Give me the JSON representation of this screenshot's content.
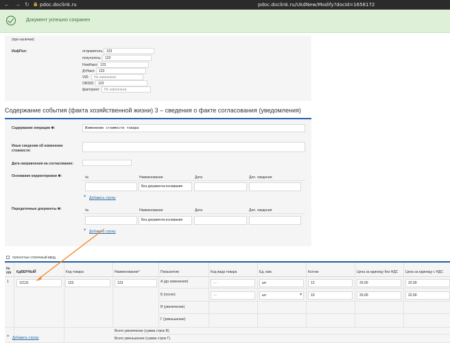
{
  "browser": {
    "site": "pdoc.doclink.ru",
    "url": "pdoc.doclink.ru/UkdNew/Modify?docId=1658172"
  },
  "alert": {
    "message": "Документ успешно сохранен"
  },
  "info": {
    "if_present_label": "(при наличии):",
    "infpol_label": "ИнфПол:",
    "fields": [
      {
        "label": "отправитель:",
        "value": "123"
      },
      {
        "label": "получатель:",
        "value": "123"
      },
      {
        "label": "НомНакл:",
        "value": "123"
      },
      {
        "label": "ДтНакл:",
        "value": "123"
      },
      {
        "label": "VID:",
        "value": "Не заполнено",
        "placeholder": true
      },
      {
        "label": "ORDID:",
        "value": "123"
      },
      {
        "label": "факторинг:",
        "value": "Не заполнена",
        "placeholder": true
      }
    ]
  },
  "section": {
    "title": "Содержание события (факта хозяйственной жизни) 3 – сведения о факте согласования (уведомления)",
    "content_label": "Содержание операции ✱:",
    "content_value": "Изменение стоимости товара",
    "other_info_label": "Иные сведения об изменении стоимости:",
    "send_date_label": "Дата направления на согласование:",
    "basis_label": "Основание корректировки ✱:",
    "transfer_label": "Передаточные документы ✱:",
    "cols": [
      "№",
      "Наименование",
      "Дата",
      "Доп. сведения"
    ],
    "doc_name_value": "Без документа-основания",
    "add_row": "Добавить строку"
  },
  "manual": {
    "label": "полностью статичный ввод"
  },
  "table": {
    "headers": [
      "№ п/п",
      "КдВЕРНЫЙ",
      "Код товара",
      "Наименование*",
      "Показатели",
      "Код вида товара",
      "Ед. изм.",
      "Кол-во",
      "Цена за единицу без НДС",
      "Цена за единицу с НДС"
    ],
    "row_no": "1",
    "kd": "12131",
    "code": "123",
    "name": "123",
    "indicators": [
      "А (до изменения)",
      "Б (после)",
      "В (увеличение)",
      "Г (уменьшение)"
    ],
    "kind_dash": "---",
    "unit": "шт",
    "qty": [
      "12",
      "10"
    ],
    "price_no_vat": [
      "20.00",
      "20.00"
    ],
    "price_vat": [
      "22.00",
      "22.00"
    ],
    "total_increase": "Всего увеличение (сумма строк В)",
    "total_decrease": "Всего уменьшение (сумма строк Г)",
    "add_row": "Добавить строку"
  }
}
